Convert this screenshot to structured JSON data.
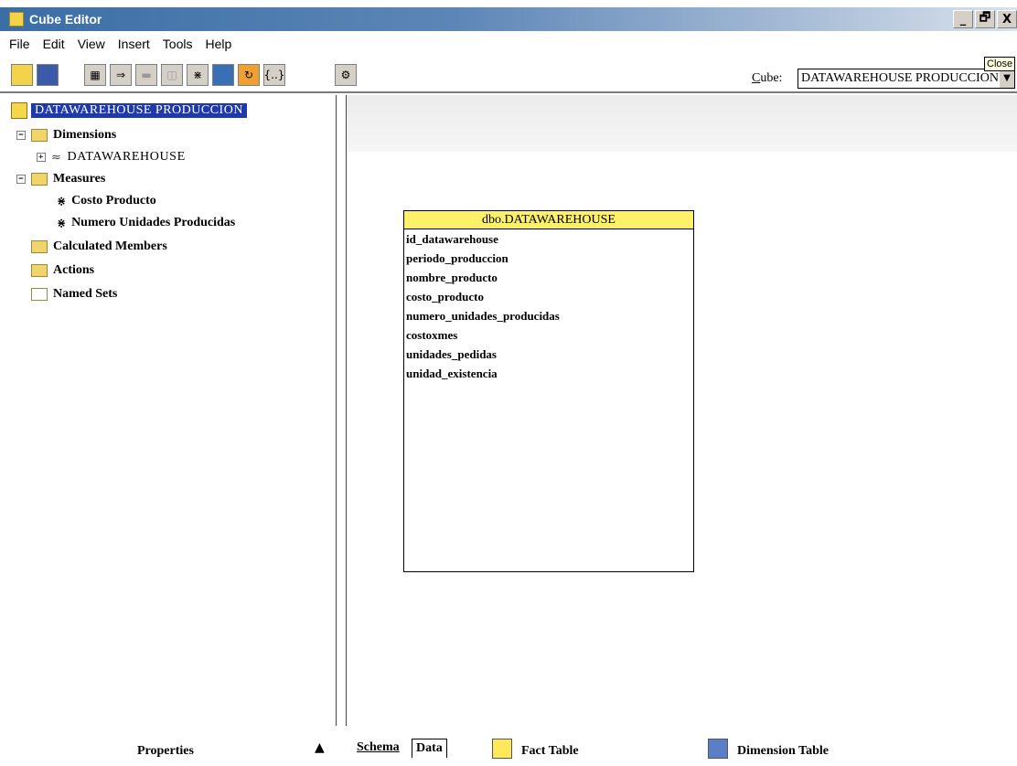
{
  "window": {
    "title": "Cube Editor",
    "controls": {
      "minimize": "_",
      "restore": "И",
      "close": "X"
    }
  },
  "menu": [
    "File",
    "Edit",
    "View",
    "Insert",
    "Tools",
    "Help"
  ],
  "toolbar": {
    "cube_label_prefix": "C",
    "cube_label_rest": "ube:",
    "cube_value": "DATAWAREHOUSE PRODUCCION",
    "tooltip": "Close"
  },
  "tree": {
    "root": "DATAWAREHOUSE PRODUCCION",
    "dimensions": "Dimensions",
    "dimension_item": "DATAWAREHOUSE",
    "measures": "Measures",
    "measure_1": "Costo Producto",
    "measure_2": "Numero Unidades Producidas",
    "calculated_members": "Calculated Members",
    "actions": "Actions",
    "named_sets": "Named Sets"
  },
  "schema": {
    "table_name": "dbo.DATAWAREHOUSE",
    "fields": [
      "id_datawarehouse",
      "periodo_produccion",
      "nombre_producto",
      "costo_producto",
      "numero_unidades_producidas",
      "costoxmes",
      "unidades_pedidas",
      "unidad_existencia"
    ]
  },
  "bottom": {
    "properties": "Properties",
    "tab_schema": "Schema",
    "tab_data": "Data",
    "legend_fact": "Fact Table",
    "legend_dimension": "Dimension Table"
  },
  "colors": {
    "fact_table": "#ffe85a",
    "dimension_table": "#5a7fc8",
    "selection": "#1f3aa8"
  }
}
